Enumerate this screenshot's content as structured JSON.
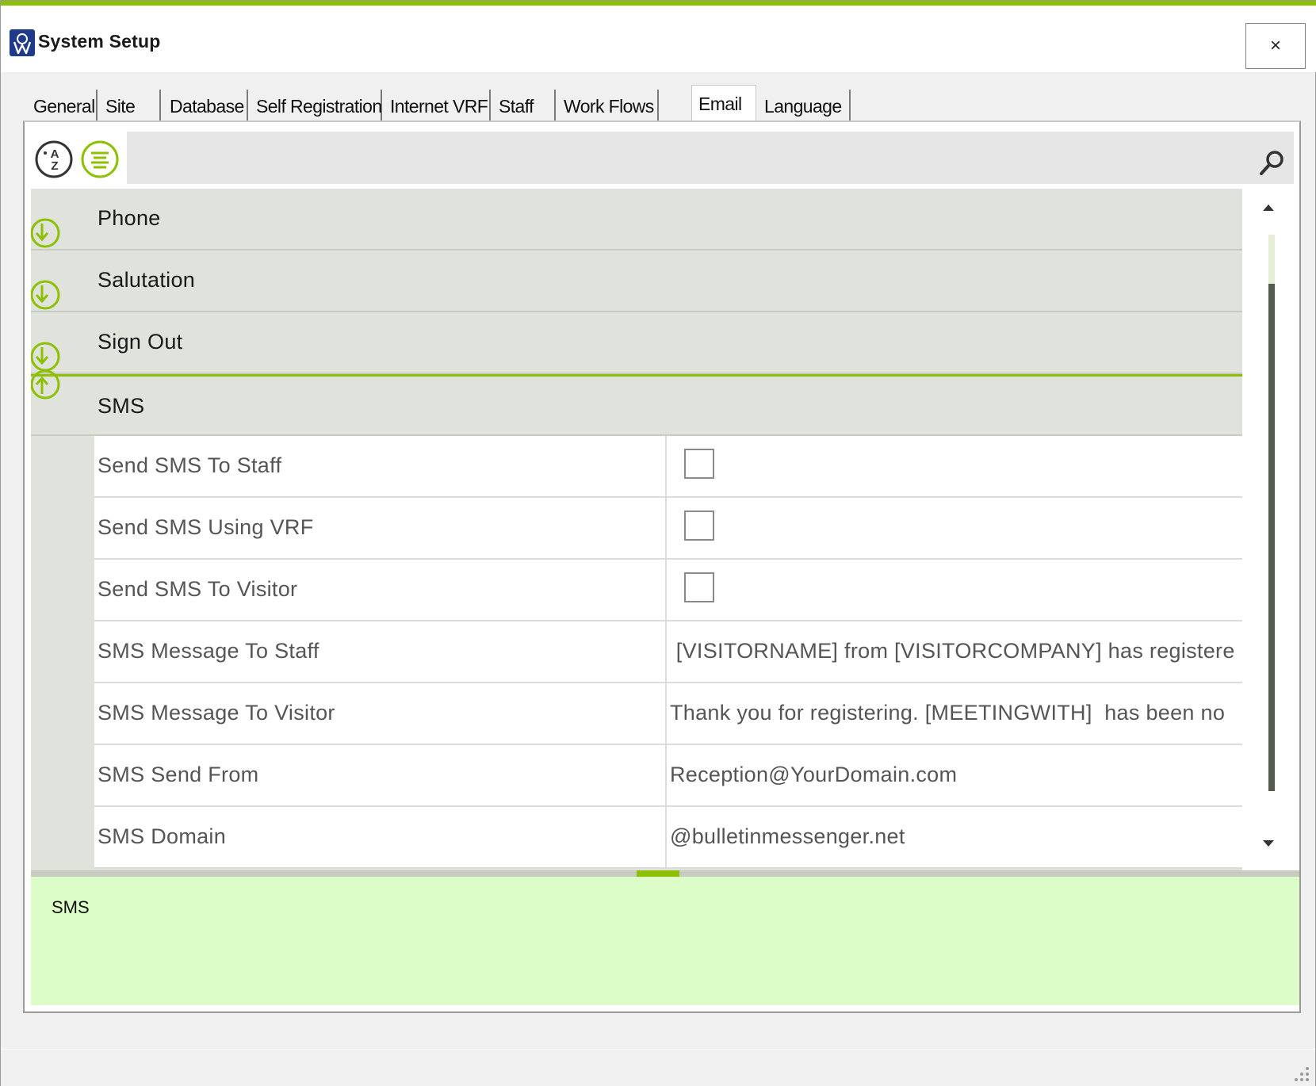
{
  "window": {
    "title": "System Setup",
    "close_glyph": "×",
    "accent_color": "#8cc000"
  },
  "tabs": [
    {
      "label": "General"
    },
    {
      "label": "Site"
    },
    {
      "label": "Database"
    },
    {
      "label": "Self Registration"
    },
    {
      "label": "Internet VRF"
    },
    {
      "label": "Staff"
    },
    {
      "label": "Work Flows"
    },
    {
      "label": "Email",
      "active": true
    },
    {
      "label": "Language"
    }
  ],
  "toolbar": {
    "sort_alpha_icon": "sort-alphabetical-icon",
    "categorized_icon": "categorized-list-icon",
    "search_value": "",
    "search_icon": "search-icon"
  },
  "categories": [
    {
      "label": "Phone",
      "expanded": false
    },
    {
      "label": "Salutation",
      "expanded": false
    },
    {
      "label": "Sign Out",
      "expanded": false
    },
    {
      "label": "SMS",
      "expanded": true
    }
  ],
  "properties": [
    {
      "name": "Send SMS To Staff",
      "type": "checkbox",
      "checked": false
    },
    {
      "name": "Send SMS Using VRF",
      "type": "checkbox",
      "checked": false
    },
    {
      "name": "Send SMS To Visitor",
      "type": "checkbox",
      "checked": false
    },
    {
      "name": "SMS Message To Staff",
      "type": "text",
      "value": " [VISITORNAME] from [VISITORCOMPANY] has registere"
    },
    {
      "name": "SMS Message To Visitor",
      "type": "text",
      "value": "Thank you for registering. [MEETINGWITH]  has been no"
    },
    {
      "name": "SMS Send From",
      "type": "text",
      "value": "Reception@YourDomain.com"
    },
    {
      "name": "SMS Domain",
      "type": "text",
      "value": "@bulletinmessenger.net"
    }
  ],
  "help": {
    "text": "SMS"
  }
}
